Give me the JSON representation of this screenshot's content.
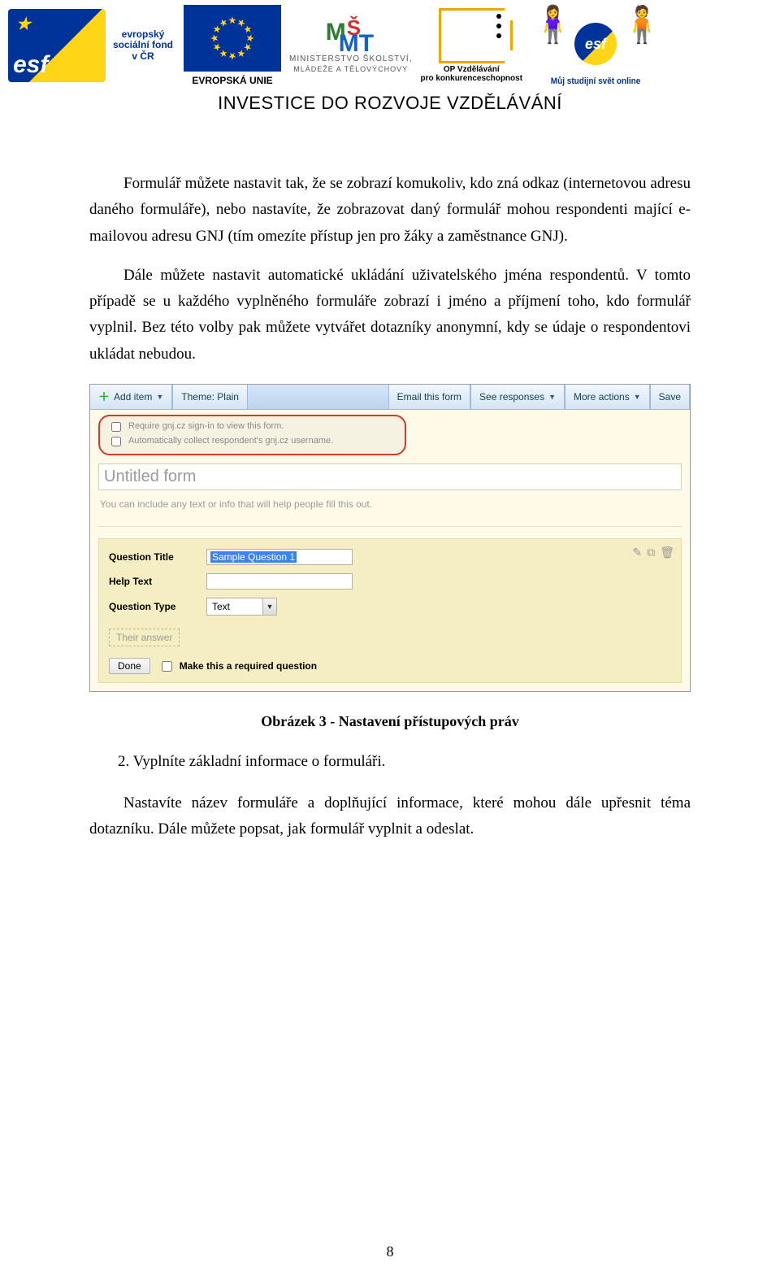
{
  "header": {
    "esf_text": "evropský sociální fond v ČR",
    "eu_label": "EVROPSKÁ UNIE",
    "msmt_line1": "MINISTERSTVO ŠKOLSTVÍ,",
    "msmt_line2": "MLÁDEŽE A TĚLOVÝCHOVY",
    "op_line1": "OP Vzdělávání",
    "op_line2": "pro konkurenceschopnost",
    "world_text": "Můj studijní svět online",
    "banner": "INVESTICE DO ROZVOJE VZDĚLÁVÁNÍ"
  },
  "body": {
    "p1": "Formulář můžete nastavit tak, že se zobrazí komukoliv, kdo zná odkaz (internetovou adresu daného formuláře), nebo nastavíte, že zobrazovat daný formulář mohou respondenti mající e-mailovou adresu GNJ (tím omezíte přístup jen pro žáky a zaměstnance GNJ).",
    "p2": "Dále můžete nastavit automatické ukládání uživatelského jména respondentů. V tomto případě se u každého vyplněného formuláře zobrazí i jméno a příjmení toho, kdo formulář vyplnil. Bez této volby pak můžete vytvářet dotazníky anonymní, kdy se údaje o respondentovi ukládat nebudou."
  },
  "figure": {
    "toolbar": {
      "add_item": "Add item",
      "theme": "Theme: Plain",
      "email": "Email this form",
      "responses": "See responses",
      "more": "More actions",
      "save": "Save"
    },
    "opts": {
      "opt1": "Require gnj.cz sign-in to view this form.",
      "opt2": "Automatically collect respondent's gnj.cz username."
    },
    "title_placeholder": "Untitled form",
    "desc_placeholder": "You can include any text or info that will help people fill this out.",
    "q": {
      "title_label": "Question Title",
      "title_value": "Sample Question 1",
      "help_label": "Help Text",
      "type_label": "Question Type",
      "type_value": "Text",
      "answer_placeholder": "Their answer",
      "done": "Done",
      "required": "Make this a required question"
    }
  },
  "caption": "Obrázek 3 - Nastavení přístupových práv",
  "list_item": "2. Vyplníte základní informace o formuláři.",
  "closing": "Nastavíte název formuláře a doplňující informace, které mohou dále upřesnit téma dotazníku. Dále můžete popsat, jak formulář vyplnit a odeslat.",
  "page_number": "8"
}
